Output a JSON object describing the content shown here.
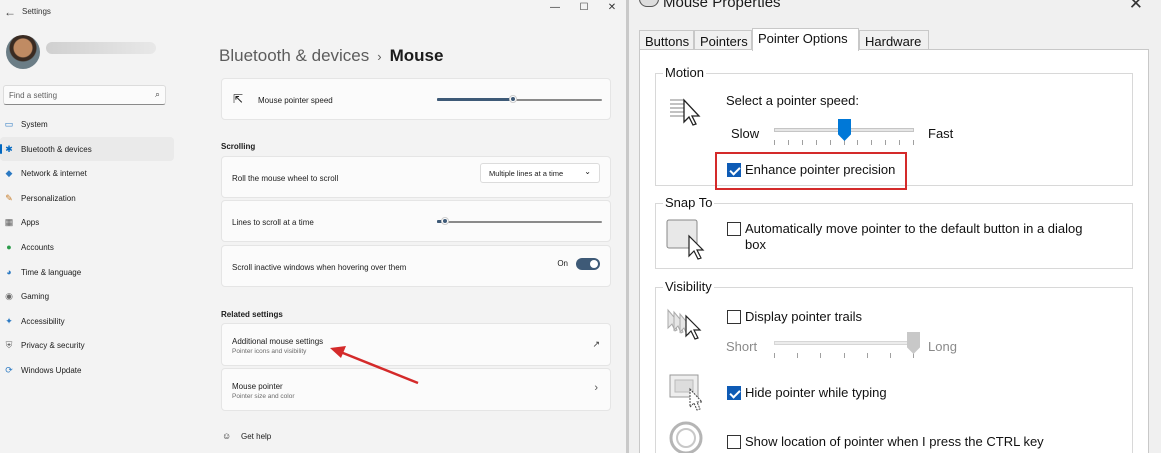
{
  "settings": {
    "app_title": "Settings",
    "window_controls": [
      "—",
      "☐",
      "✕"
    ],
    "search_placeholder": "Find a setting",
    "nav": [
      {
        "label": "System",
        "icon": "monitor-icon",
        "glyph": "▭",
        "color": "#2b79c2"
      },
      {
        "label": "Bluetooth & devices",
        "icon": "bluetooth-icon",
        "glyph": "✱",
        "color": "#0067c0"
      },
      {
        "label": "Network & internet",
        "icon": "wifi-icon",
        "glyph": "◆",
        "color": "#2b79c2"
      },
      {
        "label": "Personalization",
        "icon": "brush-icon",
        "glyph": "✎",
        "color": "#c77b27"
      },
      {
        "label": "Apps",
        "icon": "apps-icon",
        "glyph": "▦",
        "color": "#5c5c5c"
      },
      {
        "label": "Accounts",
        "icon": "person-icon",
        "glyph": "●",
        "color": "#2b9b4a"
      },
      {
        "label": "Time & language",
        "icon": "globe-icon",
        "glyph": "◕",
        "color": "#2b79c2"
      },
      {
        "label": "Gaming",
        "icon": "controller-icon",
        "glyph": "◉",
        "color": "#6b6b6b"
      },
      {
        "label": "Accessibility",
        "icon": "accessibility-icon",
        "glyph": "✦",
        "color": "#2b79c2"
      },
      {
        "label": "Privacy & security",
        "icon": "shield-icon",
        "glyph": "⛨",
        "color": "#6b6b6b"
      },
      {
        "label": "Windows Update",
        "icon": "update-icon",
        "glyph": "⟳",
        "color": "#2b79c2"
      }
    ],
    "active_nav_index": 1,
    "breadcrumb": {
      "parent": "Bluetooth & devices",
      "separator": "›",
      "current": "Mouse"
    },
    "pointer_speed": {
      "label": "Mouse pointer speed",
      "value_fraction": 0.46
    },
    "scrolling": {
      "header": "Scrolling",
      "roll_label": "Roll the mouse wheel to scroll",
      "roll_value": "Multiple lines at a time",
      "lines_label": "Lines to scroll at a time",
      "lines_value_fraction": 0.05,
      "inactive_label": "Scroll inactive windows when hovering over them",
      "inactive_state": "On"
    },
    "related": {
      "header": "Related settings",
      "additional_title": "Additional mouse settings",
      "additional_sub": "Pointer icons and visibility",
      "pointer_title": "Mouse pointer",
      "pointer_sub": "Pointer size and color"
    },
    "help_label": "Get help",
    "annotation_arrow_color": "#d42a2a"
  },
  "dialog": {
    "title": "Mouse Properties",
    "tabs": [
      "Buttons",
      "Pointers",
      "Pointer Options",
      "Hardware"
    ],
    "active_tab": "Pointer Options",
    "motion": {
      "title": "Motion",
      "prompt": "Select a pointer speed:",
      "slow": "Slow",
      "fast": "Fast",
      "speed_fraction": 0.5,
      "precision_label": "Enhance pointer precision",
      "precision_checked": true
    },
    "snap": {
      "title": "Snap To",
      "label_line1": "Automatically move pointer to the default button in a dialog",
      "label_line2": "box",
      "checked": false
    },
    "visibility": {
      "title": "Visibility",
      "trails_label": "Display pointer trails",
      "trails_checked": false,
      "short": "Short",
      "long": "Long",
      "trails_fraction": 1.0,
      "hide_label": "Hide pointer while typing",
      "hide_checked": true,
      "ctrl_label": "Show location of pointer when I press the CTRL key",
      "ctrl_checked": false
    },
    "highlight_color": "#d42a2a",
    "accent": "#0078d7"
  }
}
